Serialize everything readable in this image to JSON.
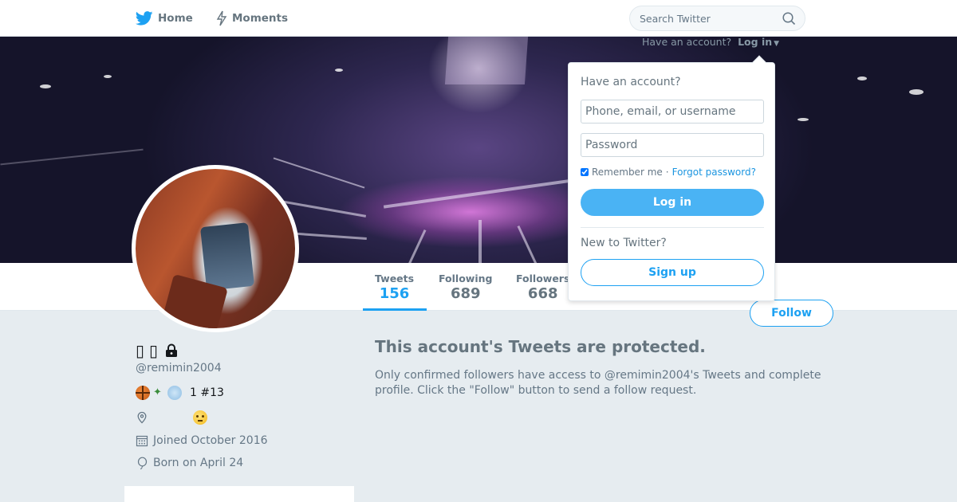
{
  "nav": {
    "home_label": "Home",
    "moments_label": "Moments",
    "search_placeholder": "Search Twitter"
  },
  "header": {
    "have_account_text": "Have an account?",
    "login_link": "Log in"
  },
  "profile": {
    "display_name_glyphs": [
      "▯",
      "▯"
    ],
    "handle": "@remimin2004",
    "bio_text": "1 #13",
    "bio_icons": [
      "basketball-emoji",
      "runner-emoji",
      "wind-emoji"
    ],
    "location_icon": "location-pin-icon",
    "location_emoji": "face-with-rolling-eyes-emoji",
    "joined": "Joined October 2016",
    "born": "Born on April 24",
    "protected": true
  },
  "stats": [
    {
      "label": "Tweets",
      "value": "156",
      "active": true
    },
    {
      "label": "Following",
      "value": "689",
      "active": false
    },
    {
      "label": "Followers",
      "value": "668",
      "active": false
    }
  ],
  "follow_button": "Follow",
  "protected_notice": {
    "title": "This account's Tweets are protected.",
    "text": "Only confirmed followers have access to @remimin2004's Tweets and complete profile. Click the \"Follow\" button to send a follow request."
  },
  "login_dropdown": {
    "heading": "Have an account?",
    "username_placeholder": "Phone, email, or username",
    "password_placeholder": "Password",
    "remember_label": "Remember me",
    "separator": "·",
    "forgot_link": "Forgot password?",
    "login_button": "Log in",
    "new_heading": "New to Twitter?",
    "signup_button": "Sign up"
  },
  "colors": {
    "accent": "#1da1f2",
    "login_button_bg": "#4ab3f4",
    "page_bg": "#e6ecf0",
    "muted_text": "#657786"
  }
}
